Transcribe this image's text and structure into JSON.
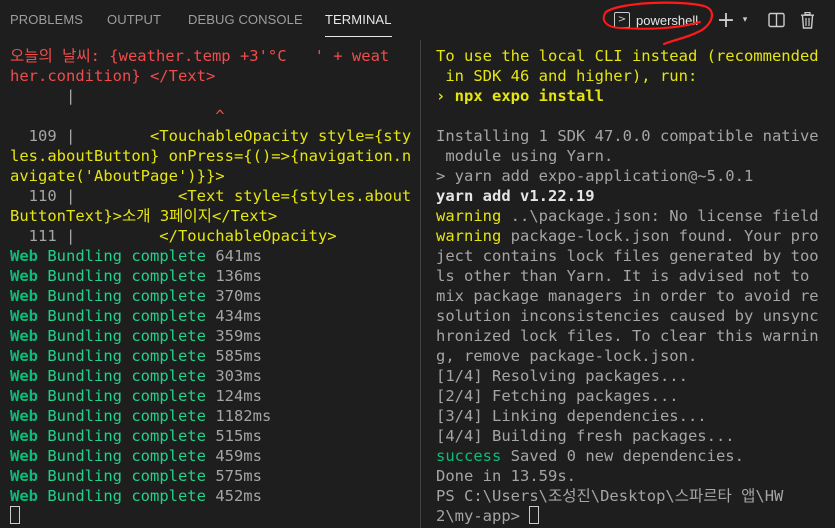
{
  "tabs": {
    "problems": "PROBLEMS",
    "output": "OUTPUT",
    "debug_console": "DEBUG CONSOLE",
    "terminal": "TERMINAL"
  },
  "toolbar": {
    "shell_label": "powershell",
    "shell_icon": "terminal-powershell-icon",
    "add_icon": "+",
    "dropdown_icon": "▾",
    "split_icon": "◫",
    "trash_icon": "🗑",
    "more_icon": "…"
  },
  "colors": {
    "background": "#1e1e1e",
    "error_red": "#f14c4c",
    "warning_yellow": "#e5e510",
    "success_green": "#23d18b",
    "annotation_red": "#ff1a1a"
  },
  "left_terminal": {
    "lines": [
      [
        {
          "t": "오늘의 날씨: {weather.temp +3'°C   ' + weat",
          "c": "red"
        }
      ],
      [
        {
          "t": "her.condition} </Text>",
          "c": "red"
        }
      ],
      [
        {
          "t": "      |",
          "c": "grey"
        }
      ],
      [
        {
          "t": "                      ^",
          "c": "red"
        }
      ],
      [
        {
          "t": "  109 | ",
          "c": "grey"
        },
        {
          "t": "       <TouchableOpacity style={sty",
          "c": "yellow"
        }
      ],
      [
        {
          "t": "les.aboutButton} onPress={()=>{navigation.n",
          "c": "yellow"
        }
      ],
      [
        {
          "t": "avigate('AboutPage')}}>",
          "c": "yellow"
        }
      ],
      [
        {
          "t": "  110 | ",
          "c": "grey"
        },
        {
          "t": "          <Text style={styles.about",
          "c": "yellow"
        }
      ],
      [
        {
          "t": "ButtonText}>소개 3페이지</Text>",
          "c": "yellow"
        }
      ],
      [
        {
          "t": "  111 | ",
          "c": "grey"
        },
        {
          "t": "        </TouchableOpacity>",
          "c": "yellow"
        }
      ],
      [
        {
          "t": "Web",
          "c": "dgreen bold"
        },
        {
          "t": " Bundling complete ",
          "c": "green"
        },
        {
          "t": "641ms",
          "c": "grey"
        }
      ],
      [
        {
          "t": "Web",
          "c": "dgreen bold"
        },
        {
          "t": " Bundling complete ",
          "c": "green"
        },
        {
          "t": "136ms",
          "c": "grey"
        }
      ],
      [
        {
          "t": "Web",
          "c": "dgreen bold"
        },
        {
          "t": " Bundling complete ",
          "c": "green"
        },
        {
          "t": "370ms",
          "c": "grey"
        }
      ],
      [
        {
          "t": "Web",
          "c": "dgreen bold"
        },
        {
          "t": " Bundling complete ",
          "c": "green"
        },
        {
          "t": "434ms",
          "c": "grey"
        }
      ],
      [
        {
          "t": "Web",
          "c": "dgreen bold"
        },
        {
          "t": " Bundling complete ",
          "c": "green"
        },
        {
          "t": "359ms",
          "c": "grey"
        }
      ],
      [
        {
          "t": "Web",
          "c": "dgreen bold"
        },
        {
          "t": " Bundling complete ",
          "c": "green"
        },
        {
          "t": "585ms",
          "c": "grey"
        }
      ],
      [
        {
          "t": "Web",
          "c": "dgreen bold"
        },
        {
          "t": " Bundling complete ",
          "c": "green"
        },
        {
          "t": "303ms",
          "c": "grey"
        }
      ],
      [
        {
          "t": "Web",
          "c": "dgreen bold"
        },
        {
          "t": " Bundling complete ",
          "c": "green"
        },
        {
          "t": "124ms",
          "c": "grey"
        }
      ],
      [
        {
          "t": "Web",
          "c": "dgreen bold"
        },
        {
          "t": " Bundling complete ",
          "c": "green"
        },
        {
          "t": "1182ms",
          "c": "grey"
        }
      ],
      [
        {
          "t": "Web",
          "c": "dgreen bold"
        },
        {
          "t": " Bundling complete ",
          "c": "green"
        },
        {
          "t": "515ms",
          "c": "grey"
        }
      ],
      [
        {
          "t": "Web",
          "c": "dgreen bold"
        },
        {
          "t": " Bundling complete ",
          "c": "green"
        },
        {
          "t": "459ms",
          "c": "grey"
        }
      ],
      [
        {
          "t": "Web",
          "c": "dgreen bold"
        },
        {
          "t": " Bundling complete ",
          "c": "green"
        },
        {
          "t": "575ms",
          "c": "grey"
        }
      ],
      [
        {
          "t": "Web",
          "c": "dgreen bold"
        },
        {
          "t": " Bundling complete ",
          "c": "green"
        },
        {
          "t": "452ms",
          "c": "grey"
        }
      ],
      [
        {
          "cursor": true
        }
      ]
    ]
  },
  "right_terminal": {
    "lines": [
      [
        {
          "t": "To use the local CLI instead (recommended",
          "c": "yellow"
        }
      ],
      [
        {
          "t": " in SDK 46 and higher), run:",
          "c": "yellow"
        }
      ],
      [
        {
          "t": "› npx expo install",
          "c": "yellow bold"
        }
      ],
      [
        {
          "t": "",
          "c": "grey"
        }
      ],
      [
        {
          "t": "Installing 1 SDK 47.0.0 compatible native",
          "c": "grey"
        }
      ],
      [
        {
          "t": " module using Yarn.",
          "c": "grey"
        }
      ],
      [
        {
          "t": "> yarn add expo-application@~5.0.1",
          "c": "grey"
        }
      ],
      [
        {
          "t": "yarn add v1.22.19",
          "c": "white bold"
        }
      ],
      [
        {
          "t": "warning",
          "c": "yellow"
        },
        {
          "t": " ..\\package.json: No license field",
          "c": "grey"
        }
      ],
      [
        {
          "t": "warning",
          "c": "yellow"
        },
        {
          "t": " package-lock.json found. Your pro",
          "c": "grey"
        }
      ],
      [
        {
          "t": "ject contains lock files generated by too",
          "c": "grey"
        }
      ],
      [
        {
          "t": "ls other than Yarn. It is advised not to",
          "c": "grey"
        }
      ],
      [
        {
          "t": "mix package managers in order to avoid re",
          "c": "grey"
        }
      ],
      [
        {
          "t": "solution inconsistencies caused by unsync",
          "c": "grey"
        }
      ],
      [
        {
          "t": "hronized lock files. To clear this warnin",
          "c": "grey"
        }
      ],
      [
        {
          "t": "g, remove package-lock.json.",
          "c": "grey"
        }
      ],
      [
        {
          "t": "[1/4] Resolving packages...",
          "c": "grey"
        }
      ],
      [
        {
          "t": "[2/4] Fetching packages...",
          "c": "grey"
        }
      ],
      [
        {
          "t": "[3/4] Linking dependencies...",
          "c": "grey"
        }
      ],
      [
        {
          "t": "[4/4] Building fresh packages...",
          "c": "grey"
        }
      ],
      [
        {
          "t": "success",
          "c": "dgreen"
        },
        {
          "t": " Saved 0 new dependencies.",
          "c": "grey"
        }
      ],
      [
        {
          "t": "Done in 13.59s.",
          "c": "grey"
        }
      ],
      [
        {
          "t": "PS C:\\Users\\조성진\\Desktop\\스파르타 앱\\HW",
          "c": "grey"
        }
      ],
      [
        {
          "t": "2\\my-app> ",
          "c": "grey"
        },
        {
          "cursor": true
        }
      ]
    ]
  }
}
